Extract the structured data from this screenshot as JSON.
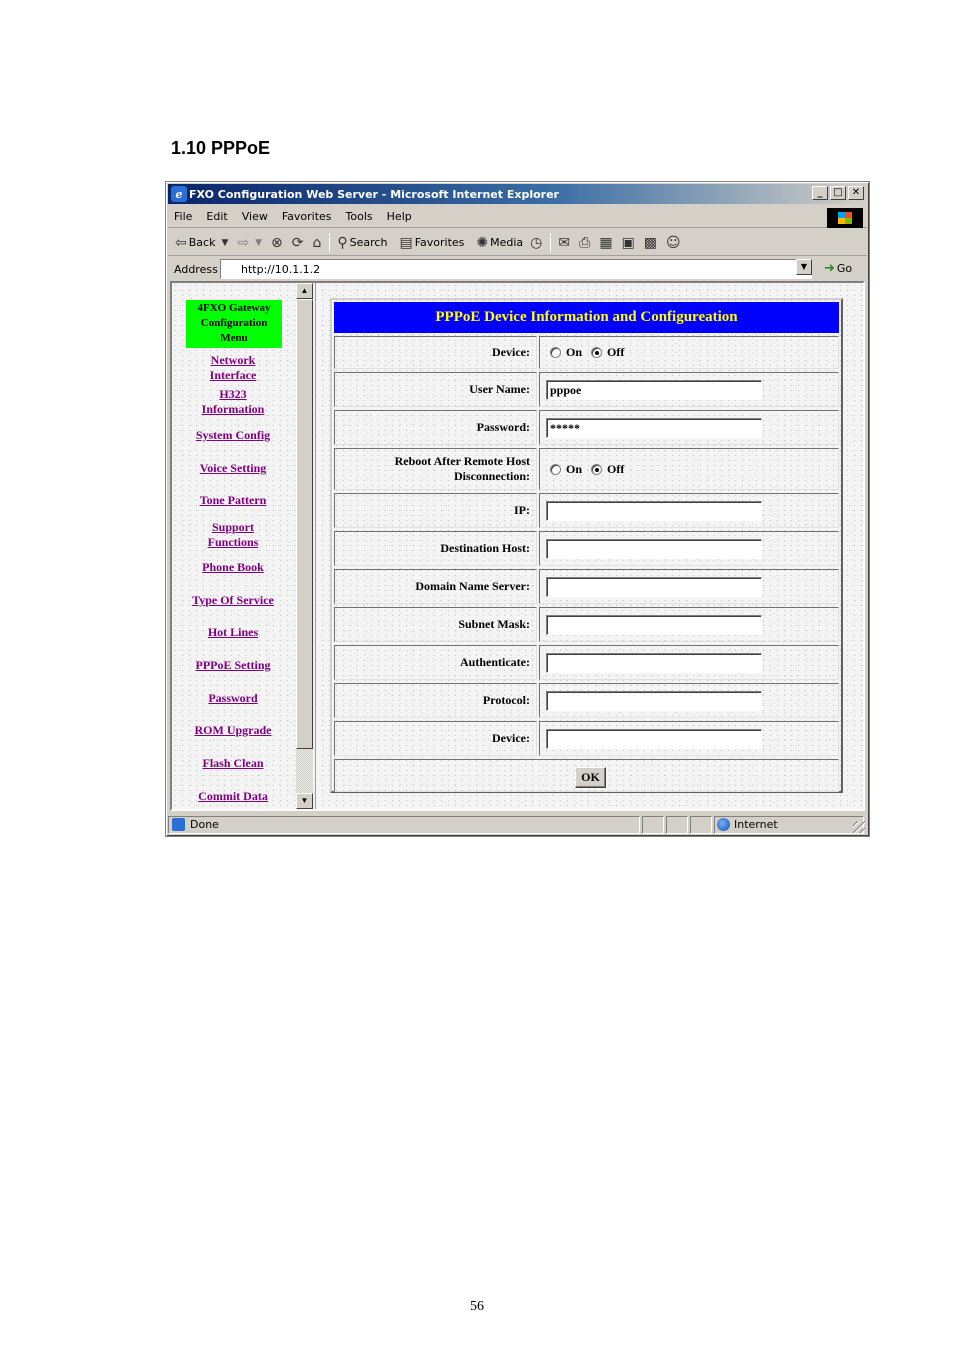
{
  "document": {
    "heading": "1.10 PPPoE",
    "page_number": "56"
  },
  "browser": {
    "title": "FXO Configuration Web Server - Microsoft Internet Explorer",
    "menu": [
      "File",
      "Edit",
      "View",
      "Favorites",
      "Tools",
      "Help"
    ],
    "toolbar": {
      "back": "Back",
      "search": "Search",
      "favorites": "Favorites",
      "media": "Media"
    },
    "address_label": "Address",
    "address_url": "http://10.1.1.2",
    "go_label": "Go",
    "status_text": "Done",
    "zone_text": "Internet"
  },
  "sidebar": {
    "badge": [
      "4FXO Gateway",
      "Configuration",
      "Menu"
    ],
    "links": [
      {
        "label": [
          "Network",
          "Interface"
        ]
      },
      {
        "label": [
          "H323",
          "Information"
        ]
      },
      {
        "label": [
          "System Config"
        ]
      },
      {
        "label": [
          "Voice Setting"
        ]
      },
      {
        "label": [
          "Tone Pattern"
        ]
      },
      {
        "label": [
          "Support",
          "Functions"
        ]
      },
      {
        "label": [
          "Phone Book"
        ]
      },
      {
        "label": [
          "Type Of Service"
        ]
      },
      {
        "label": [
          "Hot Lines"
        ]
      },
      {
        "label": [
          "PPPoE Setting"
        ]
      },
      {
        "label": [
          "Password"
        ]
      },
      {
        "label": [
          "ROM Upgrade"
        ]
      },
      {
        "label": [
          "Flash Clean"
        ]
      },
      {
        "label": [
          "Commit Data"
        ]
      }
    ]
  },
  "form": {
    "header": "PPPoE Device Information and Configureation",
    "device": {
      "label": "Device:",
      "on": "On",
      "off": "Off",
      "selected": "Off"
    },
    "user_name": {
      "label": "User Name:",
      "value": "pppoe"
    },
    "password": {
      "label": "Password:",
      "value": "*****"
    },
    "reboot": {
      "label": [
        "Reboot After Remote Host",
        "Disconnection:"
      ],
      "on": "On",
      "off": "Off",
      "selected": "Off"
    },
    "ip": {
      "label": "IP:",
      "value": ""
    },
    "destination_host": {
      "label": "Destination Host:",
      "value": ""
    },
    "dns": {
      "label": "Domain Name Server:",
      "value": ""
    },
    "subnet_mask": {
      "label": "Subnet Mask:",
      "value": ""
    },
    "authenticate": {
      "label": "Authenticate:",
      "value": ""
    },
    "protocol": {
      "label": "Protocol:",
      "value": ""
    },
    "device2": {
      "label": "Device:",
      "value": ""
    },
    "ok_label": "OK"
  },
  "colors": {
    "header_bg": "#0000ff",
    "header_text": "#ffff00",
    "badge_bg": "#00ff00",
    "link_color": "#800080"
  }
}
